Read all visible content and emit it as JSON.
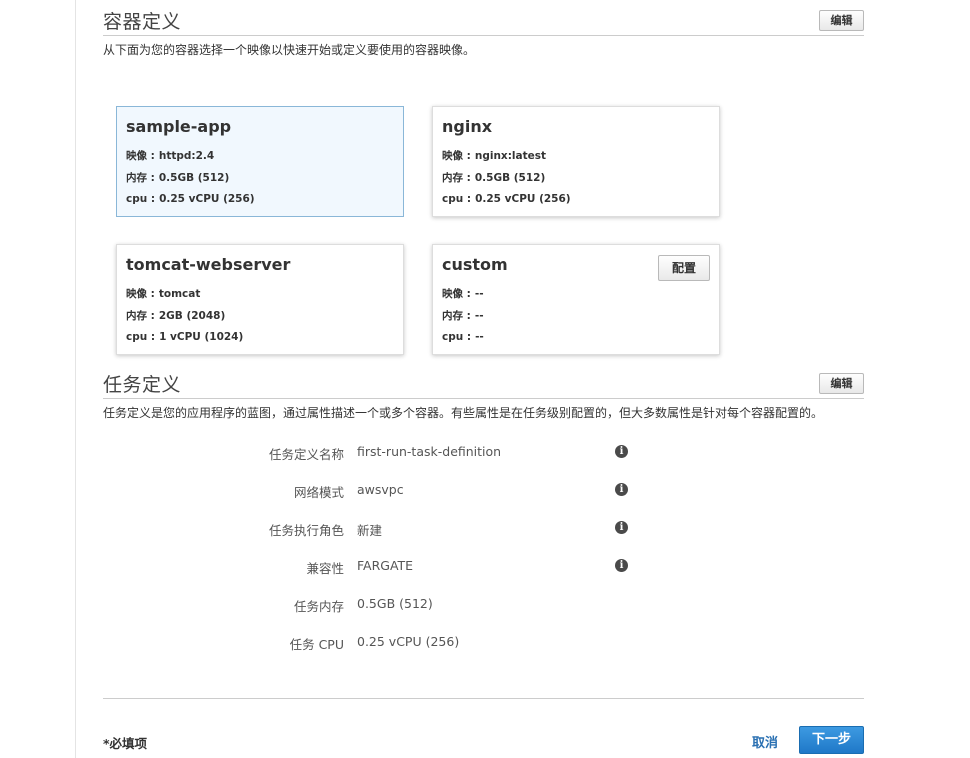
{
  "container_section": {
    "title": "容器定义",
    "edit_label": "编辑",
    "description": "从下面为您的容器选择一个映像以快速开始或定义要使用的容器映像。",
    "cards": [
      {
        "name": "sample-app",
        "selected": true,
        "image_label": "映像 :",
        "image": "httpd:2.4",
        "memory_label": "内存 :",
        "memory": "0.5GB (512)",
        "cpu_label": "cpu :",
        "cpu": "0.25 vCPU (256)"
      },
      {
        "name": "nginx",
        "selected": false,
        "image_label": "映像 :",
        "image": "nginx:latest",
        "memory_label": "内存 :",
        "memory": "0.5GB (512)",
        "cpu_label": "cpu :",
        "cpu": "0.25 vCPU (256)"
      },
      {
        "name": "tomcat-webserver",
        "selected": false,
        "image_label": "映像 :",
        "image": "tomcat",
        "memory_label": "内存 :",
        "memory": "2GB (2048)",
        "cpu_label": "cpu :",
        "cpu": "1 vCPU (1024)"
      },
      {
        "name": "custom",
        "selected": false,
        "image_label": "映像 :",
        "image": "--",
        "memory_label": "内存 :",
        "memory": "--",
        "cpu_label": "cpu :",
        "cpu": "--",
        "config_label": "配置"
      }
    ]
  },
  "task_section": {
    "title": "任务定义",
    "edit_label": "编辑",
    "description": "任务定义是您的应用程序的蓝图，通过属性描述一个或多个容器。有些属性是在任务级别配置的，但大多数属性是针对每个容器配置的。",
    "fields": [
      {
        "label": "任务定义名称",
        "value": "first-run-task-definition",
        "info_icon": true
      },
      {
        "label": "网络模式",
        "value": "awsvpc",
        "info_icon": true
      },
      {
        "label": "任务执行角色",
        "value": "新建",
        "info_icon": true
      },
      {
        "label": "兼容性",
        "value": "FARGATE",
        "info_icon": true
      },
      {
        "label": "任务内存",
        "value": "0.5GB (512)",
        "info_icon": false
      },
      {
        "label": "任务 CPU",
        "value": "0.25 vCPU (256)",
        "info_icon": false
      }
    ]
  },
  "footer": {
    "required_note": "*必填项",
    "cancel_label": "取消",
    "next_label": "下一步"
  },
  "icons": {
    "info": "info-icon",
    "info_glyph": "i"
  },
  "colors": {
    "accent": "#1f78c8",
    "link": "#2a70b2",
    "selected_card_bg": "#f1f8fe",
    "selected_card_border": "#8ab7d8"
  }
}
